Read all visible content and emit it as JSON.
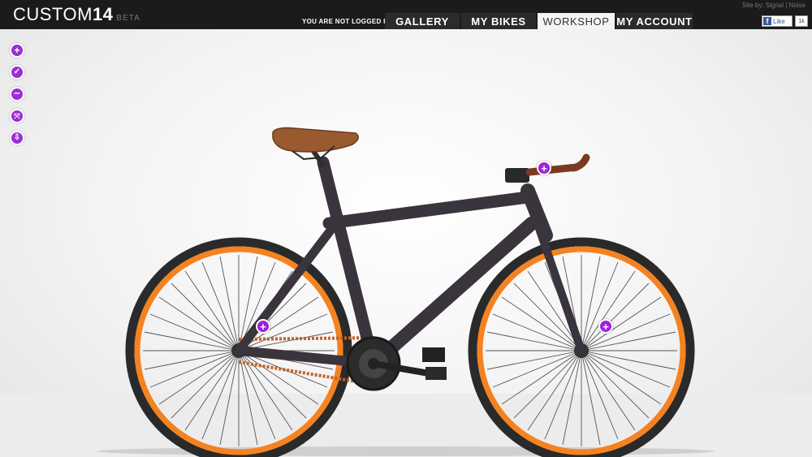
{
  "header": {
    "logo_main": "CUSTOM",
    "logo_num": "14",
    "logo_beta": "BETA",
    "login_status": "YOU ARE NOT LOGGED IN.",
    "credit": "Site by: Signal | Noise",
    "nav": [
      "GALLERY",
      "MY BIKES",
      "WORKSHOP",
      "MY ACCOUNT"
    ],
    "active_nav": "WORKSHOP",
    "fb_like": "Like",
    "fb_count": "1k"
  },
  "toolbar": {
    "add": "+",
    "check": "✓",
    "share": "∼",
    "fullscreen": "⤧",
    "save": "⇩"
  },
  "hotspots": {
    "handlebar": "+",
    "rear_wheel": "+",
    "front_wheel": "+"
  },
  "colors": {
    "frame": "#3a343c",
    "rim": "#f58220",
    "tire": "#2a2a2a",
    "saddle": "#9a5a30",
    "hotspot": "#a21fe0"
  }
}
